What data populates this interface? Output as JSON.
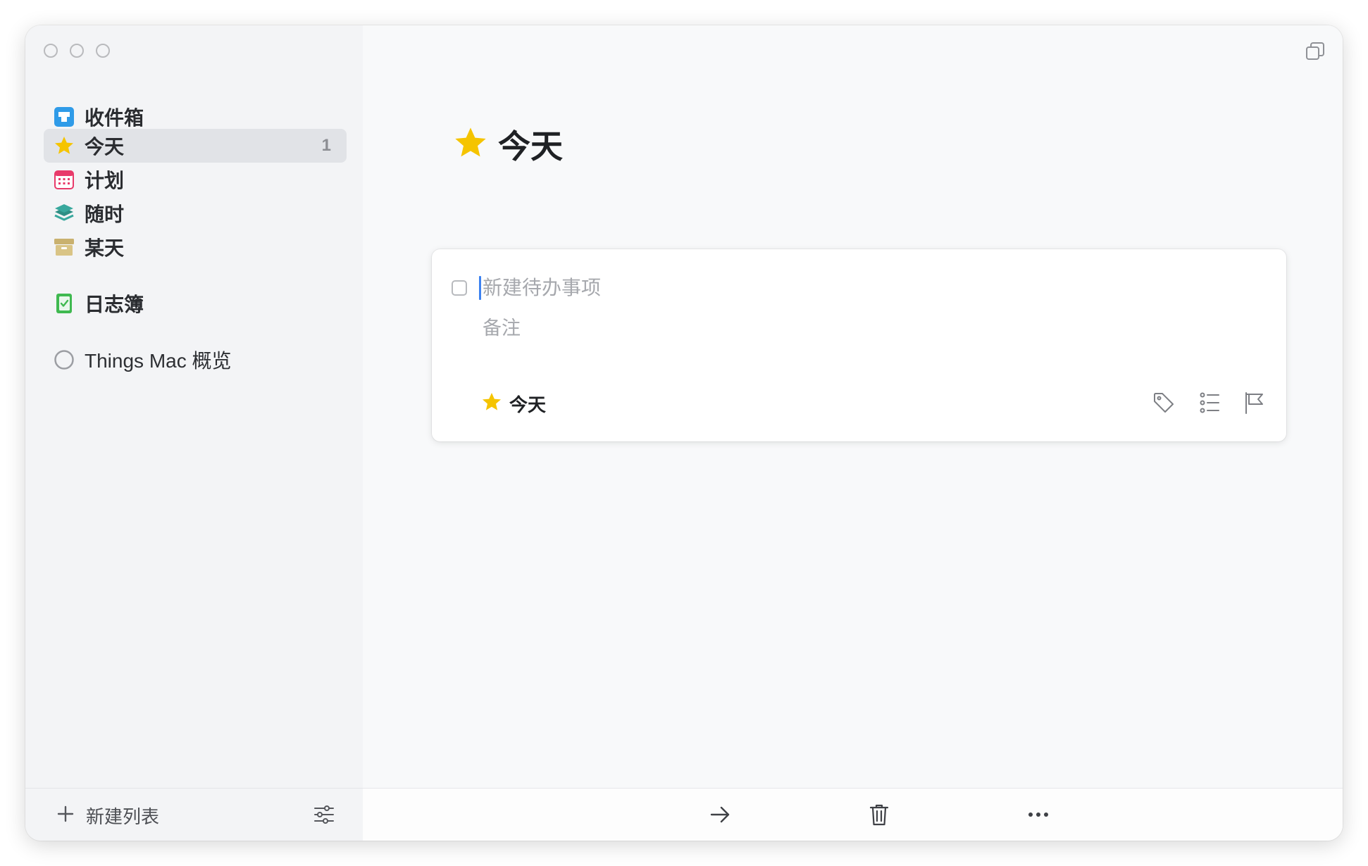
{
  "sidebar": {
    "inbox": {
      "label": "收件箱",
      "icon": "inbox-icon"
    },
    "items": [
      {
        "label": "今天",
        "icon": "star-icon",
        "count": "1",
        "active": true
      },
      {
        "label": "计划",
        "icon": "calendar-icon"
      },
      {
        "label": "随时",
        "icon": "layers-icon"
      },
      {
        "label": "某天",
        "icon": "archive-box-icon"
      }
    ],
    "logbook": {
      "label": "日志簿",
      "icon": "logbook-icon"
    },
    "projects": [
      {
        "label": "Things Mac 概览",
        "icon": "project-circle-icon"
      }
    ],
    "footer": {
      "new_list_label": "新建列表",
      "filter_icon": "sliders-icon"
    }
  },
  "main": {
    "title": "今天",
    "title_icon": "star-icon",
    "todo": {
      "title_placeholder": "新建待办事项",
      "notes_placeholder": "备注",
      "when_label": "今天",
      "actions": [
        "tag-icon",
        "checklist-icon",
        "flag-icon"
      ]
    },
    "footer_actions": [
      "arrow-right-icon",
      "trash-icon",
      "more-icon"
    ]
  },
  "colors": {
    "star": "#f5c400",
    "inbox": "#2f9be8",
    "calendar": "#e83a6a",
    "anytime": "#38a89d",
    "someday": "#c9b16f",
    "logbook": "#3fb950",
    "cursor": "#3d82f0"
  }
}
